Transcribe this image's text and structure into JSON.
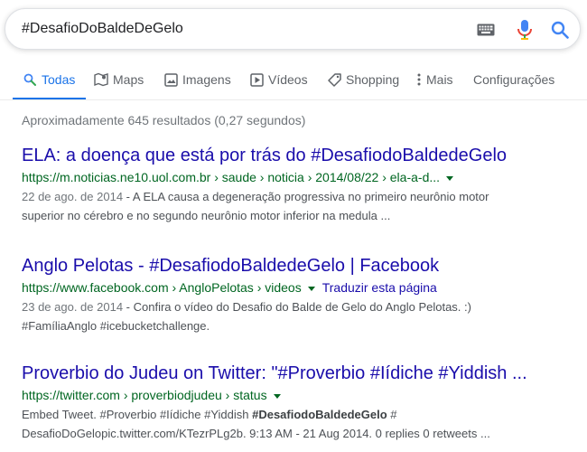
{
  "search": {
    "query": "#DesafioDoBaldeDeGelo"
  },
  "tabs": [
    {
      "label": "Todas",
      "icon": "search-icon"
    },
    {
      "label": "Maps",
      "icon": "map-icon"
    },
    {
      "label": "Imagens",
      "icon": "image-icon"
    },
    {
      "label": "Vídeos",
      "icon": "play-icon"
    },
    {
      "label": "Shopping",
      "icon": "tag-icon"
    },
    {
      "label": "Mais",
      "icon": "more-vert-icon"
    },
    {
      "label": "Configurações",
      "icon": ""
    }
  ],
  "stats": "Aproximadamente 645 resultados (0,27 segundos)",
  "results": [
    {
      "title": "ELA: a doença que está por trás do #DesafiodoBaldedeGelo",
      "url": "https://m.noticias.ne10.uol.com.br › saude › noticia › 2014/08/22 › ela-a-d...",
      "translate": "",
      "date": "22 de ago. de 2014",
      "snippet_line1": " - A ELA causa a degeneração progressiva no primeiro neurônio motor",
      "snippet_line2": "superior no cérebro e no segundo neurônio motor inferior na medula ..."
    },
    {
      "title": "Anglo Pelotas - #DesafiodoBaldedeGelo | Facebook",
      "url": "https://www.facebook.com › AngloPelotas › videos",
      "translate": "Traduzir esta página",
      "date": "23 de ago. de 2014",
      "snippet_line1": " - Confira o vídeo do Desafio do Balde de Gelo do Anglo Pelotas. :)",
      "snippet_line2": "#FamíliaAnglo #icebucketchallenge."
    },
    {
      "title": "Proverbio do Judeu on Twitter: \"#Proverbio #Iídiche #Yiddish ...",
      "url": "https://twitter.com › proverbiodjudeu › status",
      "translate": "",
      "snippet_line1_pre": "Embed Tweet. #Proverbio #Iídiche #Yiddish ",
      "snippet_line1_bold": "#DesafiodoBaldedeGelo",
      "snippet_line1_post": " #",
      "snippet_line2": "DesafioDoGelopic.twitter.com/KTezrPLg2b. 9:13 AM - 21 Aug 2014. 0 replies 0 retweets ..."
    }
  ],
  "colors": {
    "link": "#1a0dab",
    "url": "#006621",
    "accent": "#1a73e8"
  }
}
